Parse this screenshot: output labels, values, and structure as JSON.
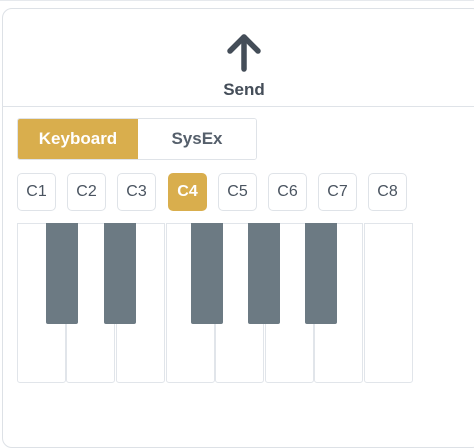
{
  "send": {
    "label": "Send",
    "icon": "arrow-up-icon"
  },
  "mode_toggle": {
    "options": [
      {
        "label": "Keyboard",
        "active": true
      },
      {
        "label": "SysEx",
        "active": false
      }
    ]
  },
  "octaves": {
    "items": [
      "C1",
      "C2",
      "C3",
      "C4",
      "C5",
      "C6",
      "C7",
      "C8"
    ],
    "selected": "C4"
  },
  "keyboard": {
    "white_keys": [
      "C",
      "D",
      "E",
      "F",
      "G",
      "A",
      "B",
      "C"
    ],
    "black_keys": [
      "C#",
      "D#",
      "F#",
      "G#",
      "A#"
    ]
  },
  "colors": {
    "accent": "#d9ae4d",
    "black_key": "#6c7a83",
    "text": "#444d58",
    "border": "#dfe3e8"
  }
}
